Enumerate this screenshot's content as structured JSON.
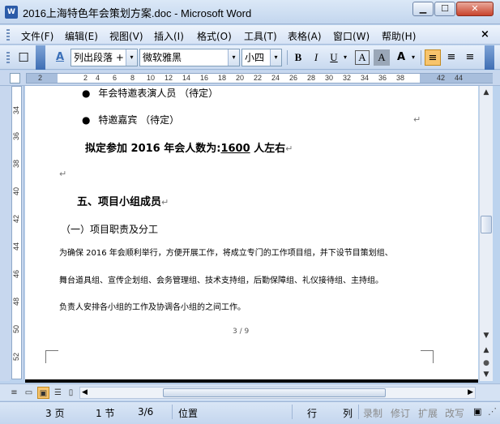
{
  "window": {
    "title": "2016上海特色年会策划方案.doc - Microsoft Word",
    "app_icon_label": "W",
    "min_icon": "▁",
    "max_icon": "☐",
    "close_icon": "✕"
  },
  "menu": {
    "items": [
      "文件(F)",
      "编辑(E)",
      "视图(V)",
      "插入(I)",
      "格式(O)",
      "工具(T)",
      "表格(A)",
      "窗口(W)",
      "帮助(H)"
    ],
    "close": "×"
  },
  "toolbar": {
    "style_value": "列出段落 +",
    "font_value": "微软雅黑",
    "size_value": "小四",
    "bold": "B",
    "italic": "I",
    "underline": "U",
    "char_border": "A",
    "char_shading": "A",
    "highlight": "A",
    "style_icon": "A",
    "dropdown_glyph": "▾",
    "align_left": "≡",
    "align_center": "≡",
    "align_right": "≡",
    "accent_color": "#f7c46c"
  },
  "ruler": {
    "ticks": [
      "2",
      "2",
      "4",
      "6",
      "8",
      "10",
      "12",
      "14",
      "16",
      "18",
      "20",
      "22",
      "24",
      "26",
      "28",
      "30",
      "32",
      "34",
      "36",
      "38",
      "42",
      "44"
    ],
    "vticks": [
      "34",
      "36",
      "38",
      "40",
      "42",
      "44",
      "46",
      "48",
      "50",
      "52"
    ]
  },
  "document": {
    "bullet_glyph": "●",
    "bullet1": "年会特邀表演人员 （待定）",
    "bullet2": "特邀嘉宾 （待定）",
    "para_mark": "↵",
    "attendance_prefix": "拟定参加 2016 年会人数为:",
    "attendance_number": "1600",
    "attendance_suffix": " 人左右",
    "heading5": "五、项目小组成员",
    "subheading": "（一）项目职责及分工",
    "body1": "为确保 2016 年会顺利举行，方便开展工作，将成立专门的工作项目组，并下设节目策划组、",
    "body2": "舞台道具组、宣传企划组、会务管理组、技术支持组，后勤保障组、礼仪接待组、主持组。",
    "body3": "负责人安排各小组的工作及协调各小组的之间工作。",
    "page_footer": "3 / 9"
  },
  "scroll": {
    "up": "▲",
    "down": "▼",
    "left": "◀",
    "right": "▶",
    "prev_page": "▲",
    "browse": "●",
    "next_page": "▼"
  },
  "status": {
    "page": "3 页",
    "section": "1 节",
    "page_of": "3/6",
    "position": "位置",
    "line": "行",
    "column": "列",
    "rec": "录制",
    "trk": "修订",
    "ext": "扩展",
    "ovr": "改写"
  }
}
